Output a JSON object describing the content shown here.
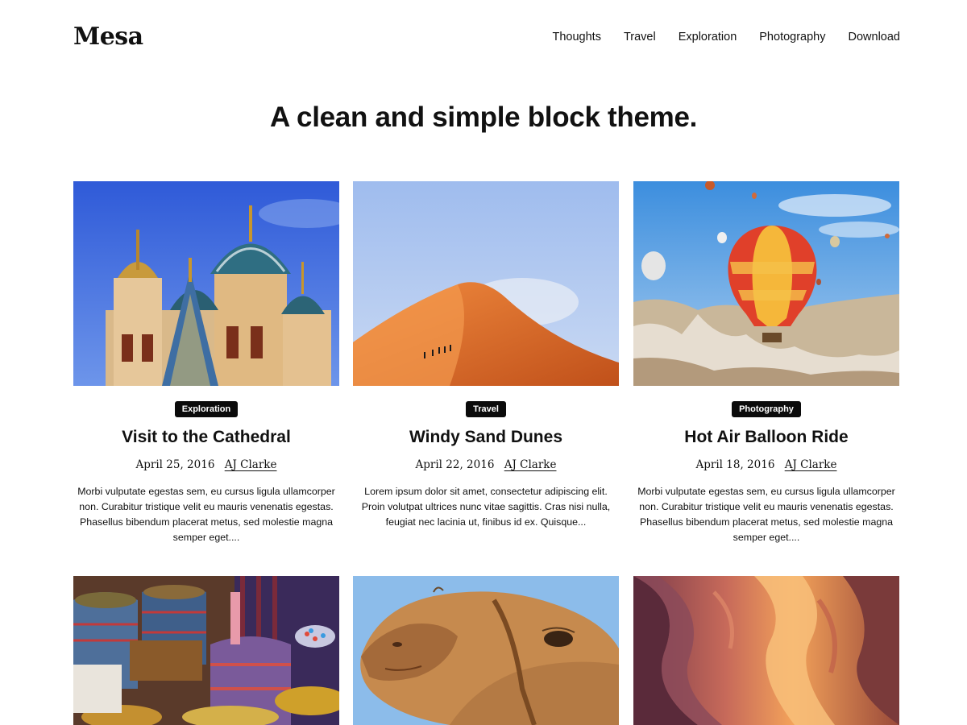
{
  "site": {
    "title": "Mesa"
  },
  "nav": {
    "items": [
      "Thoughts",
      "Travel",
      "Exploration",
      "Photography",
      "Download"
    ]
  },
  "hero": {
    "heading": "A clean and simple block theme."
  },
  "posts": [
    {
      "category": "Exploration",
      "title": "Visit to the Cathedral",
      "date": "April 25, 2016",
      "author": "AJ Clarke",
      "excerpt": "Morbi vulputate egestas sem, eu cursus ligula ullamcorper non. Curabitur tristique velit eu mauris venenatis egestas. Phasellus bibendum placerat metus, sed molestie magna semper eget....",
      "image": "cathedral-photo"
    },
    {
      "category": "Travel",
      "title": "Windy Sand Dunes",
      "date": "April 22, 2016",
      "author": "AJ Clarke",
      "excerpt": "Lorem ipsum dolor sit amet, consectetur adipiscing elit. Proin volutpat ultrices nunc vitae sagittis. Cras nisi nulla, feugiat nec lacinia ut, finibus id ex. Quisque...",
      "image": "sand-dunes-photo"
    },
    {
      "category": "Photography",
      "title": "Hot Air Balloon Ride",
      "date": "April 18, 2016",
      "author": "AJ Clarke",
      "excerpt": "Morbi vulputate egestas sem, eu cursus ligula ullamcorper non. Curabitur tristique velit eu mauris venenatis egestas. Phasellus bibendum placerat metus, sed molestie magna semper eget....",
      "image": "hot-air-balloon-photo"
    },
    {
      "image": "market-spices-photo"
    },
    {
      "image": "camel-photo"
    },
    {
      "image": "canyon-photo"
    }
  ],
  "colors": {
    "text": "#111111",
    "badge_bg": "#0b0b0b",
    "badge_text": "#ffffff",
    "background": "#ffffff"
  }
}
